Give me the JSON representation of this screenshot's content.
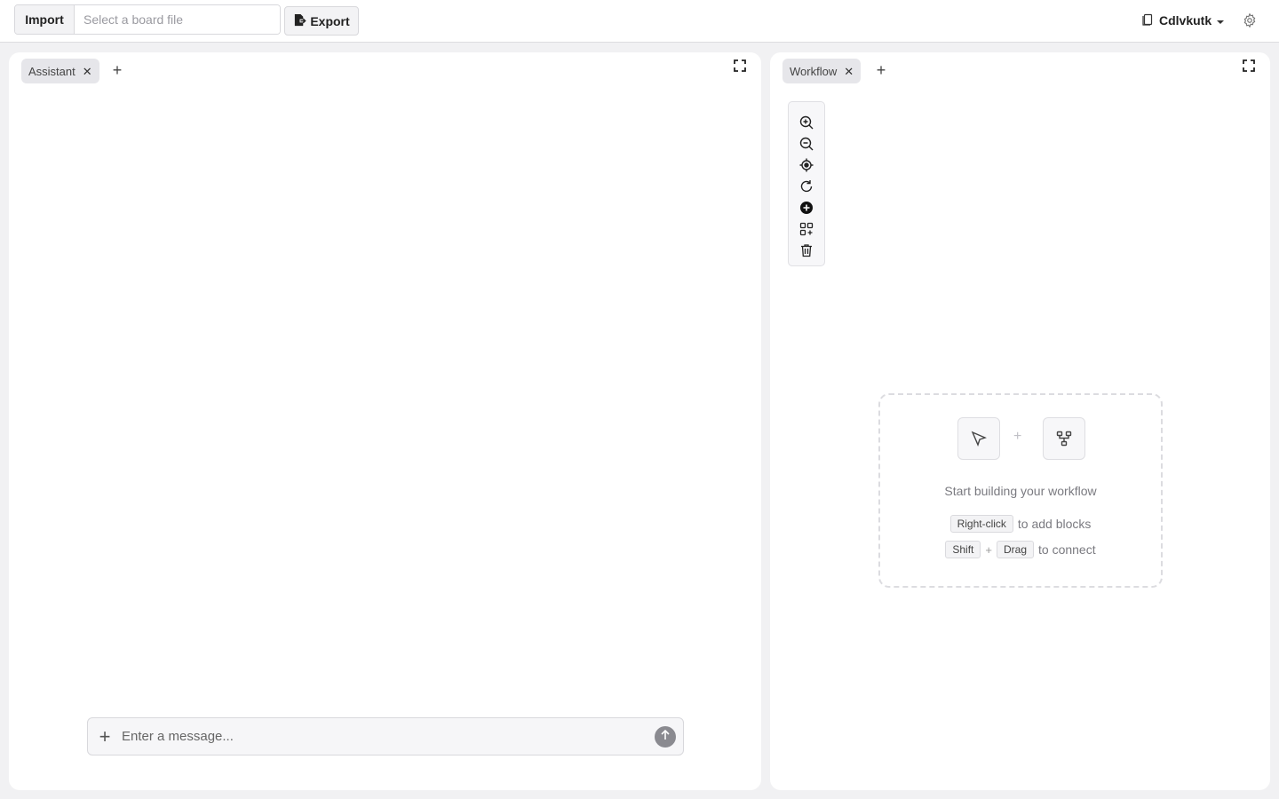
{
  "topbar": {
    "import_label": "Import",
    "file_placeholder": "Select a board file",
    "export_label": "Export",
    "workspace_name": "Cdlvkutk",
    "icons": {
      "export": "export-icon",
      "workspace": "document-icon",
      "dropdown": "caret-down-icon",
      "settings": "gear-icon"
    }
  },
  "left_panel": {
    "tabs": [
      {
        "label": "Assistant",
        "close": "✕"
      }
    ],
    "add_tab": "+",
    "chat": {
      "placeholder": "Enter a message...",
      "attach_label": "+"
    }
  },
  "right_panel": {
    "tabs": [
      {
        "label": "Workflow",
        "close": "✕"
      }
    ],
    "add_tab": "+",
    "toolbar": [
      "zoom-in-icon",
      "zoom-out-icon",
      "center-icon",
      "refresh-icon",
      "add-circle-icon",
      "grid-icon",
      "trash-icon"
    ],
    "empty_state": {
      "plus": "+",
      "title": "Start building your workflow",
      "line1": {
        "key": "Right-click",
        "text": "to add blocks"
      },
      "line2": {
        "key1": "Shift",
        "sep": "+",
        "key2": "Drag",
        "text": "to connect"
      }
    }
  }
}
